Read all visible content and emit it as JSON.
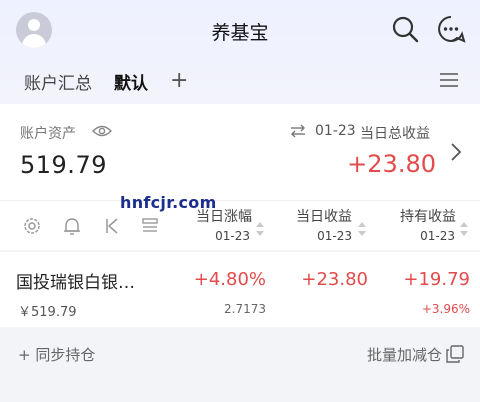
{
  "header": {
    "title": "养基宝",
    "tabs": [
      {
        "label": "账户汇总"
      },
      {
        "label": "默认"
      }
    ],
    "add_label": "+"
  },
  "summary": {
    "asset_label": "账户资产",
    "asset_value": "519.79",
    "date": "01-23",
    "profit_label": "当日总收益",
    "profit_value": "+23.80"
  },
  "watermark": "hnfcjr.com",
  "table": {
    "columns": [
      {
        "label": "当日涨幅",
        "date": "01-23"
      },
      {
        "label": "当日收益",
        "date": "01-23"
      },
      {
        "label": "持有收益",
        "date": "01-23"
      }
    ],
    "rows": [
      {
        "name": "国投瑞银白银…",
        "amount": "￥519.79",
        "change_pct": "+4.80%",
        "nav": "2.7173",
        "day_profit": "+23.80",
        "hold_profit": "+19.79",
        "hold_pct": "+3.96%"
      }
    ]
  },
  "footer": {
    "sync_label": "+ 同步持仓",
    "batch_label": "批量加减仓"
  },
  "colors": {
    "up": "#e24b4b",
    "accent": "#1b2e8e"
  }
}
